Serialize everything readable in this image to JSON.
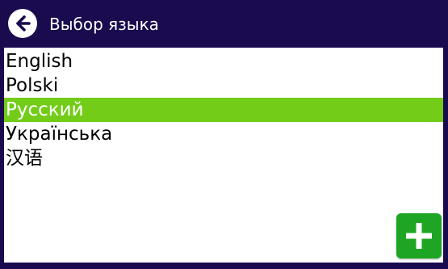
{
  "header": {
    "title": "Выбор языка",
    "back_icon": "arrow-left-circle-icon"
  },
  "languages": {
    "items": [
      {
        "label": "English",
        "selected": false
      },
      {
        "label": "Polski",
        "selected": false
      },
      {
        "label": "Русский",
        "selected": true
      },
      {
        "label": "Українська",
        "selected": false
      },
      {
        "label": "汉语",
        "selected": false
      }
    ]
  },
  "add_button": {
    "icon": "plus-icon"
  },
  "colors": {
    "background": "#1a0a4e",
    "panel": "#ffffff",
    "selection": "#72cc18",
    "add_button": "#1fa524",
    "header_text": "#ffffff"
  }
}
